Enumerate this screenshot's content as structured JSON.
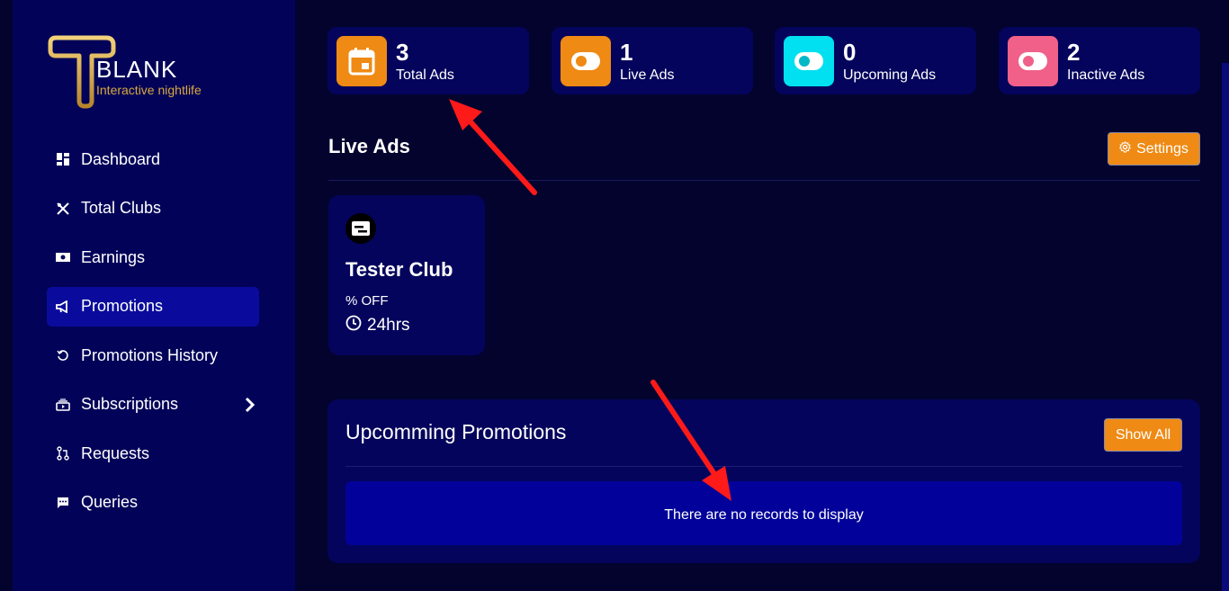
{
  "brand": {
    "name": "BLANK",
    "tagline": "Interactive nightlife"
  },
  "sidebar": {
    "items": [
      {
        "label": "Dashboard",
        "icon": "dashboard-icon",
        "active": false
      },
      {
        "label": "Total Clubs",
        "icon": "utensils-icon",
        "active": false
      },
      {
        "label": "Earnings",
        "icon": "money-icon",
        "active": false
      },
      {
        "label": "Promotions",
        "icon": "megaphone-icon",
        "active": true
      },
      {
        "label": "Promotions History",
        "icon": "history-icon",
        "active": false
      },
      {
        "label": "Subscriptions",
        "icon": "subscriptions-icon",
        "active": false,
        "has_submenu": true
      },
      {
        "label": "Requests",
        "icon": "pull-request-icon",
        "active": false
      },
      {
        "label": "Queries",
        "icon": "chat-icon",
        "active": false
      }
    ]
  },
  "stats": [
    {
      "value": "3",
      "label": "Total Ads",
      "icon": "calendar-icon",
      "color": "#ef8a14"
    },
    {
      "value": "1",
      "label": "Live Ads",
      "icon": "toggle-icon",
      "color": "#ef8a14"
    },
    {
      "value": "0",
      "label": "Upcoming Ads",
      "icon": "toggle-icon",
      "color": "#00e0f0"
    },
    {
      "value": "2",
      "label": "Inactive Ads",
      "icon": "toggle-icon",
      "color": "#f06088"
    }
  ],
  "live_ads": {
    "title": "Live Ads",
    "settings_label": "Settings",
    "cards": [
      {
        "club": "Tester Club",
        "offer": "% OFF",
        "duration": "24hrs"
      }
    ]
  },
  "upcoming": {
    "title": "Upcomming Promotions",
    "show_all_label": "Show All",
    "empty_message": "There are no records to display"
  },
  "colors": {
    "accent": "#ef8a14",
    "sidebar": "#020259",
    "background": "#03032e",
    "annotation_arrow": "#ff1a1a"
  }
}
